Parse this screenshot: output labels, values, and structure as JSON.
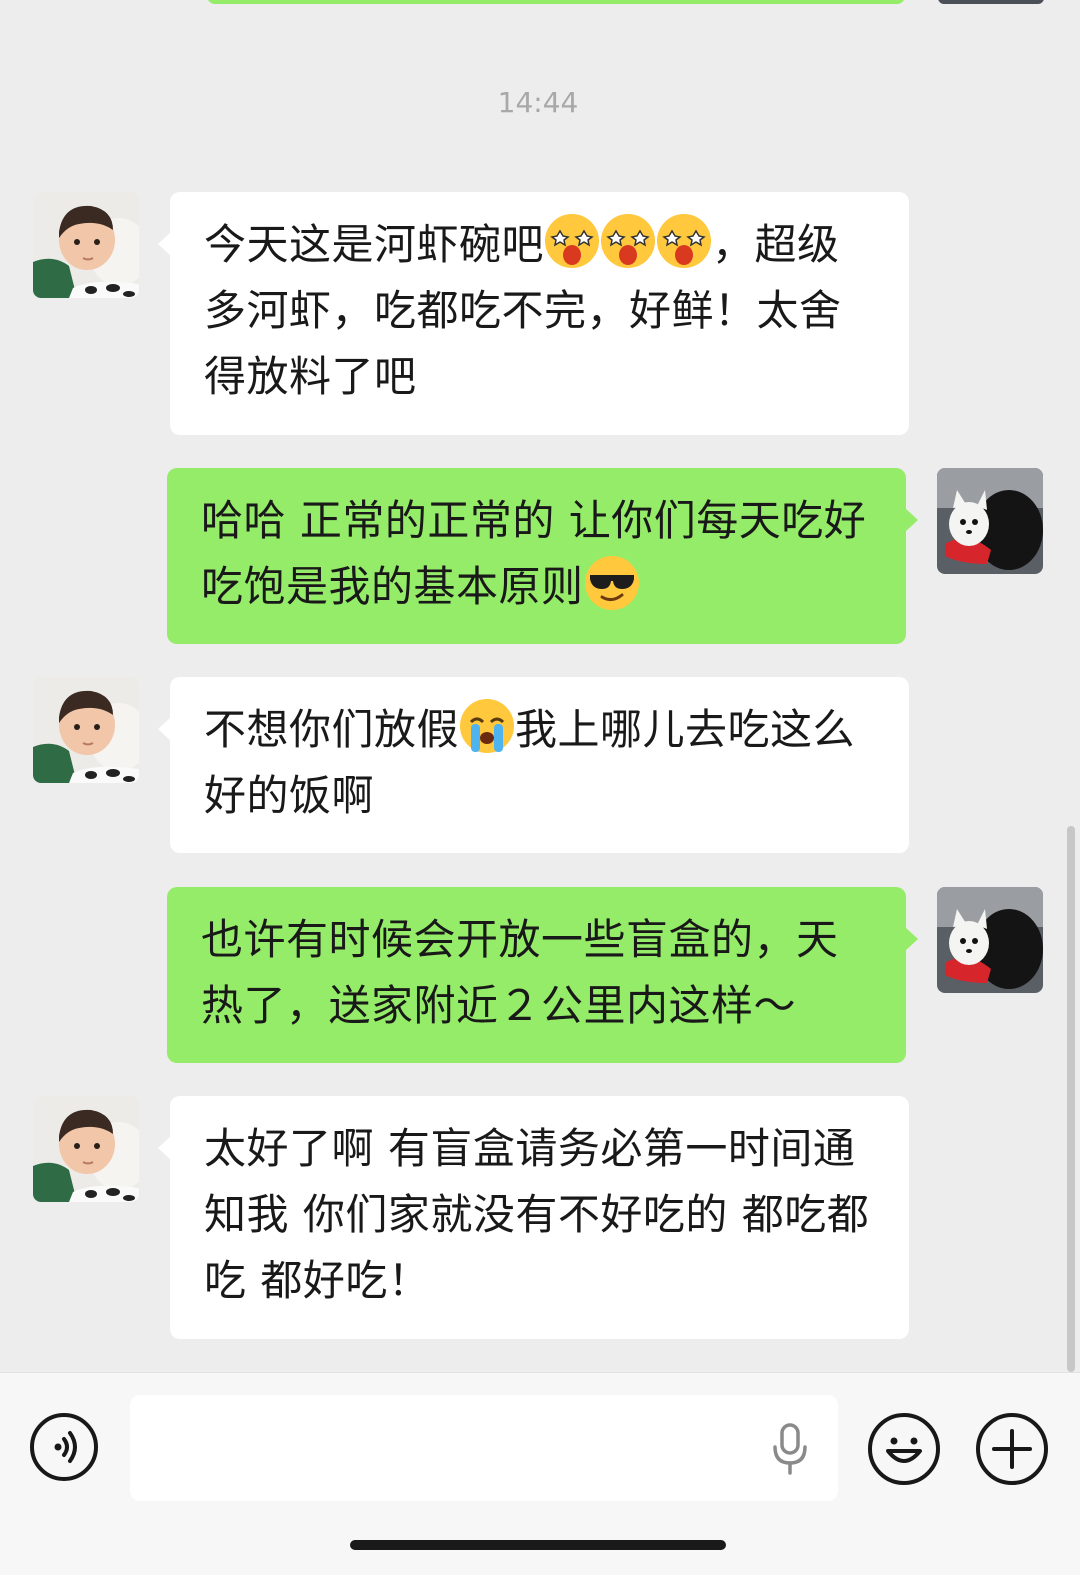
{
  "timestamp": "14:44",
  "messages": [
    {
      "side": "in",
      "avatar_icon": "baby-avatar",
      "parts": [
        "今天这是河虾碗吧",
        "",
        "，超级多河虾，吃都吃不完，好鲜！太舍得放料了吧"
      ],
      "emoji_icons": [
        "starstruck-emoji",
        "starstruck-emoji",
        "starstruck-emoji"
      ]
    },
    {
      "side": "out",
      "avatar_icon": "dog-avatar",
      "parts": [
        "哈哈 正常的正常的 让你们每天吃好吃饱是我的基本原则",
        ""
      ],
      "emoji_icons": [
        "sunglasses-emoji"
      ]
    },
    {
      "side": "in",
      "avatar_icon": "baby-avatar",
      "parts": [
        "不想你们放假",
        "我上哪儿去吃这么好的饭啊"
      ],
      "emoji_icons": [
        "crying-emoji"
      ]
    },
    {
      "side": "out",
      "avatar_icon": "dog-avatar",
      "parts": [
        "也许有时候会开放一些盲盒的，天热了，送家附近２公里内这样～"
      ],
      "emoji_icons": []
    },
    {
      "side": "in",
      "avatar_icon": "baby-avatar",
      "parts": [
        "太好了啊 有盲盒请务必第一时间通知我 你们家就没有不好吃的 都吃都吃 都好吃！"
      ],
      "emoji_icons": []
    }
  ],
  "input_bar": {
    "voice_icon": "voice-icon",
    "mic_icon": "microphone-icon",
    "emoji_icon": "smiley-icon",
    "plus_icon": "plus-icon",
    "placeholder": ""
  },
  "colors": {
    "background": "#ededed",
    "outgoing_bubble": "#95ec69",
    "incoming_bubble": "#ffffff",
    "timestamp": "#a8a8a8"
  }
}
